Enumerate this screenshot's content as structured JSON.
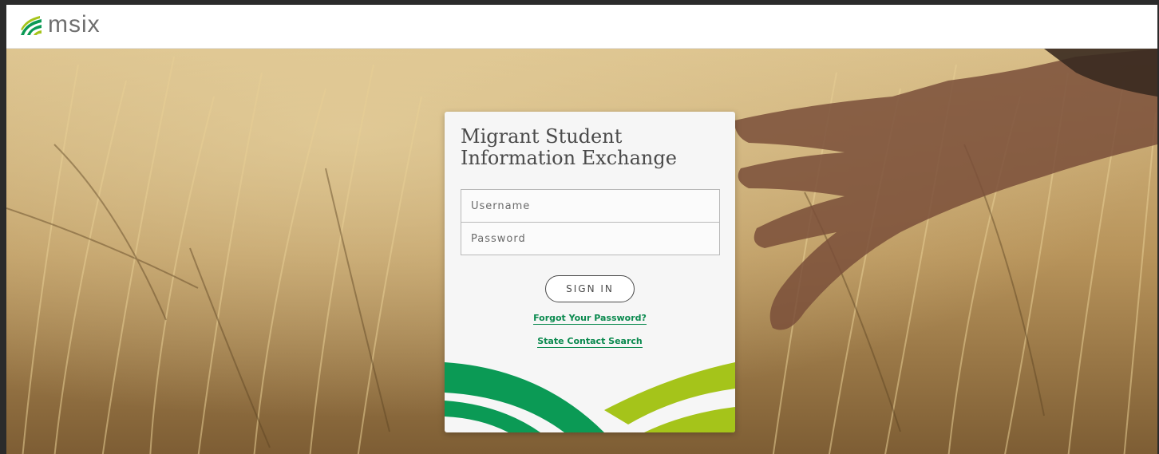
{
  "brand": {
    "name": "msix",
    "green": "#0b9a55",
    "lime": "#a5c41a"
  },
  "login": {
    "title": "Migrant Student Information Exchange",
    "username_placeholder": "Username",
    "password_placeholder": "Password",
    "signin_label": "SIGN IN",
    "forgot_password_label": "Forgot Your Password?",
    "state_contact_label": "State Contact Search"
  },
  "background": {
    "description_icon": "wheat-field-photo"
  }
}
